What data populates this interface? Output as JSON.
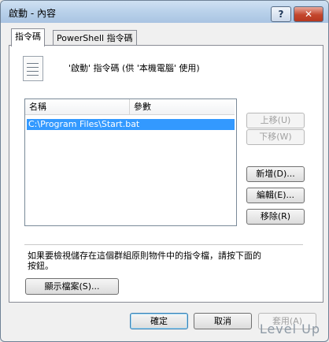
{
  "window": {
    "title": "啟動 - 內容",
    "help_label": "?",
    "close_label": "✕"
  },
  "tabs": [
    {
      "label": "指令碼"
    },
    {
      "label": "PowerShell 指令碼"
    }
  ],
  "script_panel": {
    "icon": "script-file-icon",
    "description": "'啟動' 指令碼 (供 '本機電腦' 使用)",
    "columns": [
      "名稱",
      "參數"
    ],
    "rows": [
      {
        "name": "C:\\Program Files\\Start.bat",
        "params": ""
      }
    ],
    "side_buttons": {
      "up": "上移(U)",
      "down": "下移(W)",
      "add": "新增(D)...",
      "edit": "編輯(E)...",
      "remove": "移除(R)"
    },
    "info_text": "如果要檢視儲存在這個群組原則物件中的指令檔，請按下面的按鈕。",
    "show_files": "顯示檔案(S)..."
  },
  "footer": {
    "ok": "確定",
    "cancel": "取消",
    "apply": "套用(A)"
  },
  "watermark": "Level Up"
}
